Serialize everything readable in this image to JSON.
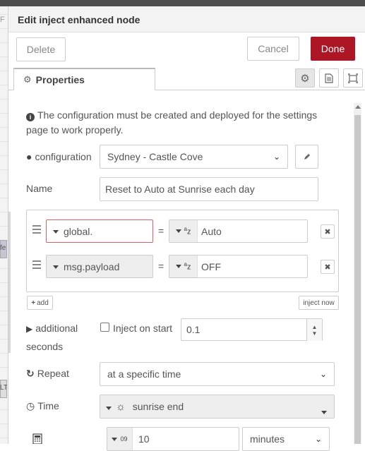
{
  "canvas": {
    "frag1": "F",
    "frag2": "fe",
    "frag3": "LT"
  },
  "dialog": {
    "title": "Edit inject enhanced node",
    "delete_label": "Delete",
    "cancel_label": "Cancel",
    "done_label": "Done"
  },
  "tabs": {
    "properties_label": "Properties",
    "icons": [
      "gear-icon",
      "description-icon",
      "appearance-icon"
    ]
  },
  "form": {
    "info_text": "The configuration must be created and deployed for the settings page to work properly.",
    "configuration_label": "configuration",
    "configuration_value": "Sydney - Castle Cove",
    "name_label": "Name",
    "name_value": "Reset to Auto at Sunrise each day",
    "rules": [
      {
        "property": "global.",
        "operator": "=",
        "value_type": "az",
        "value": "Auto"
      },
      {
        "property": "msg.payload",
        "operator": "=",
        "value_type": "az",
        "value": "OFF"
      }
    ],
    "add_label": "add",
    "inject_now_label": "inject now",
    "additional_label": "additional",
    "seconds_label": "seconds",
    "inject_on_start_label": "Inject on start",
    "inject_on_start_checked": false,
    "seconds_value": "0.1",
    "repeat_label": "Repeat",
    "repeat_value": "at a specific time",
    "time_label": "Time",
    "time_value": "sunrise end",
    "offset_type": "09",
    "offset_value": "10",
    "offset_unit": "minutes"
  },
  "colors": {
    "done_bg": "#ad1625",
    "error_border": "#d6615f"
  }
}
